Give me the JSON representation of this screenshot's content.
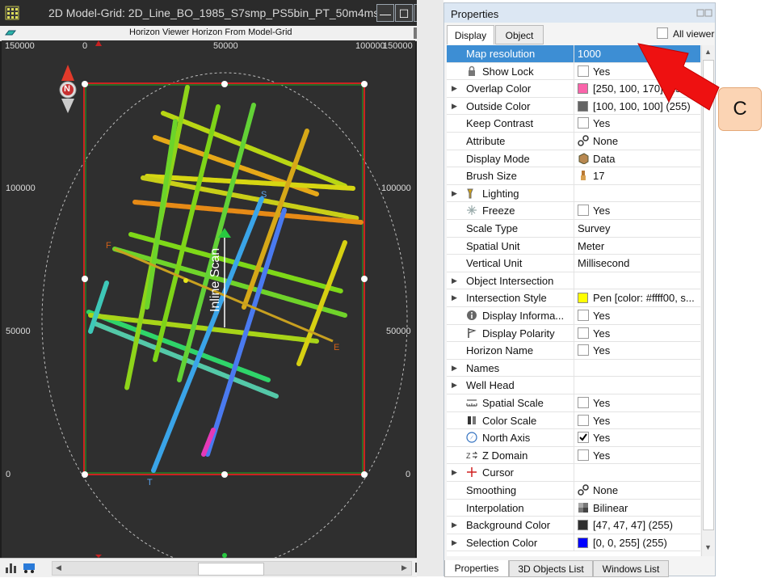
{
  "window": {
    "title": "2D Model-Grid: 2D_Line_BO_1985_S7smp_PS5bin_PT_50m4ms",
    "subtitle": "Horizon Viewer Horizon From Model-Grid",
    "minimize": "—",
    "maximize": "☐",
    "close": "✕"
  },
  "map": {
    "top_axis": [
      "150000",
      "0",
      "50000",
      "100000",
      "150000"
    ],
    "left_axis": [
      "100000",
      "50000",
      "0"
    ],
    "right_axis": [
      "100000",
      "50000",
      "0"
    ],
    "labels": {
      "S": "S",
      "F": "F",
      "E": "E",
      "T": "T",
      "inline_scan": "Inline Scan",
      "north": "N"
    },
    "colors": {
      "background": "#2f2f2f",
      "boundary": "#cc2222",
      "inner_boundary": "#22aa22",
      "ellipse": "#bdbdbd"
    }
  },
  "properties": {
    "title": "Properties",
    "tabs": [
      "Display",
      "Object"
    ],
    "all_viewers": "All viewer",
    "rows": [
      {
        "name": "Map resolution",
        "value": "1000",
        "expand": false,
        "icon": "",
        "type": "text",
        "selected": true
      },
      {
        "name": "Show Lock",
        "value": "Yes",
        "expand": false,
        "icon": "lock-icon",
        "type": "check",
        "checked": false
      },
      {
        "name": "Overlap Color",
        "value": "[250, 100, 170] (255)",
        "expand": true,
        "icon": "",
        "type": "color",
        "swatch": "#fa64aa"
      },
      {
        "name": "Outside Color",
        "value": "[100, 100, 100] (255)",
        "expand": true,
        "icon": "",
        "type": "color",
        "swatch": "#646464"
      },
      {
        "name": "Keep Contrast",
        "value": "Yes",
        "expand": false,
        "icon": "",
        "type": "check",
        "checked": false
      },
      {
        "name": "Attribute",
        "value": "None",
        "expand": false,
        "icon": "",
        "type": "iconval",
        "vicon": "link-icon"
      },
      {
        "name": "Display Mode",
        "value": "Data",
        "expand": false,
        "icon": "",
        "type": "iconval",
        "vicon": "cube-icon"
      },
      {
        "name": "Brush Size",
        "value": "17",
        "expand": false,
        "icon": "",
        "type": "iconval",
        "vicon": "brush-icon"
      },
      {
        "name": "Lighting",
        "value": "",
        "expand": true,
        "icon": "flashlight-icon",
        "type": "none"
      },
      {
        "name": "Freeze",
        "value": "Yes",
        "expand": false,
        "icon": "snowflake-icon",
        "type": "check",
        "checked": false
      },
      {
        "name": "Scale Type",
        "value": "Survey",
        "expand": false,
        "icon": "",
        "type": "text"
      },
      {
        "name": "Spatial Unit",
        "value": "Meter",
        "expand": false,
        "icon": "",
        "type": "text"
      },
      {
        "name": "Vertical Unit",
        "value": "Millisecond",
        "expand": false,
        "icon": "",
        "type": "text"
      },
      {
        "name": "Object Intersection",
        "value": "",
        "expand": true,
        "icon": "",
        "type": "none"
      },
      {
        "name": "Intersection Style",
        "value": "Pen [color: #ffff00, s...",
        "expand": true,
        "icon": "",
        "type": "color",
        "swatch": "#ffff00"
      },
      {
        "name": "Display Informa...",
        "value": "Yes",
        "expand": false,
        "icon": "info-icon",
        "type": "check",
        "checked": false
      },
      {
        "name": "Display Polarity",
        "value": "Yes",
        "expand": false,
        "icon": "flag-icon",
        "type": "check",
        "checked": false
      },
      {
        "name": "Horizon Name",
        "value": "Yes",
        "expand": false,
        "icon": "",
        "type": "check",
        "checked": false
      },
      {
        "name": "Names",
        "value": "",
        "expand": true,
        "icon": "",
        "type": "none"
      },
      {
        "name": "Well Head",
        "value": "",
        "expand": true,
        "icon": "",
        "type": "none"
      },
      {
        "name": "Spatial Scale",
        "value": "Yes",
        "expand": false,
        "icon": "scale-icon",
        "type": "check",
        "checked": false
      },
      {
        "name": "Color Scale",
        "value": "Yes",
        "expand": false,
        "icon": "colorscale-icon",
        "type": "check",
        "checked": false
      },
      {
        "name": "North Axis",
        "value": "Yes",
        "expand": false,
        "icon": "compass-icon",
        "type": "check",
        "checked": true
      },
      {
        "name": "Z Domain",
        "value": "Yes",
        "expand": false,
        "icon": "zdomain-icon",
        "type": "check",
        "checked": false
      },
      {
        "name": "Cursor",
        "value": "",
        "expand": true,
        "icon": "crosshair-icon",
        "type": "none"
      },
      {
        "name": "Smoothing",
        "value": "None",
        "expand": false,
        "icon": "",
        "type": "iconval",
        "vicon": "link-icon"
      },
      {
        "name": "Interpolation",
        "value": "Bilinear",
        "expand": false,
        "icon": "",
        "type": "iconval",
        "vicon": "interp-icon"
      },
      {
        "name": "Background Color",
        "value": "[47, 47, 47] (255)",
        "expand": true,
        "icon": "",
        "type": "color",
        "swatch": "#2f2f2f"
      },
      {
        "name": "Selection Color",
        "value": "[0, 0, 255] (255)",
        "expand": true,
        "icon": "",
        "type": "color",
        "swatch": "#0000ff"
      }
    ],
    "bottom_tabs": [
      "Properties",
      "3D Objects List",
      "Windows List"
    ]
  },
  "annotation": {
    "label": "C",
    "arrow_color": "#ee1111"
  }
}
